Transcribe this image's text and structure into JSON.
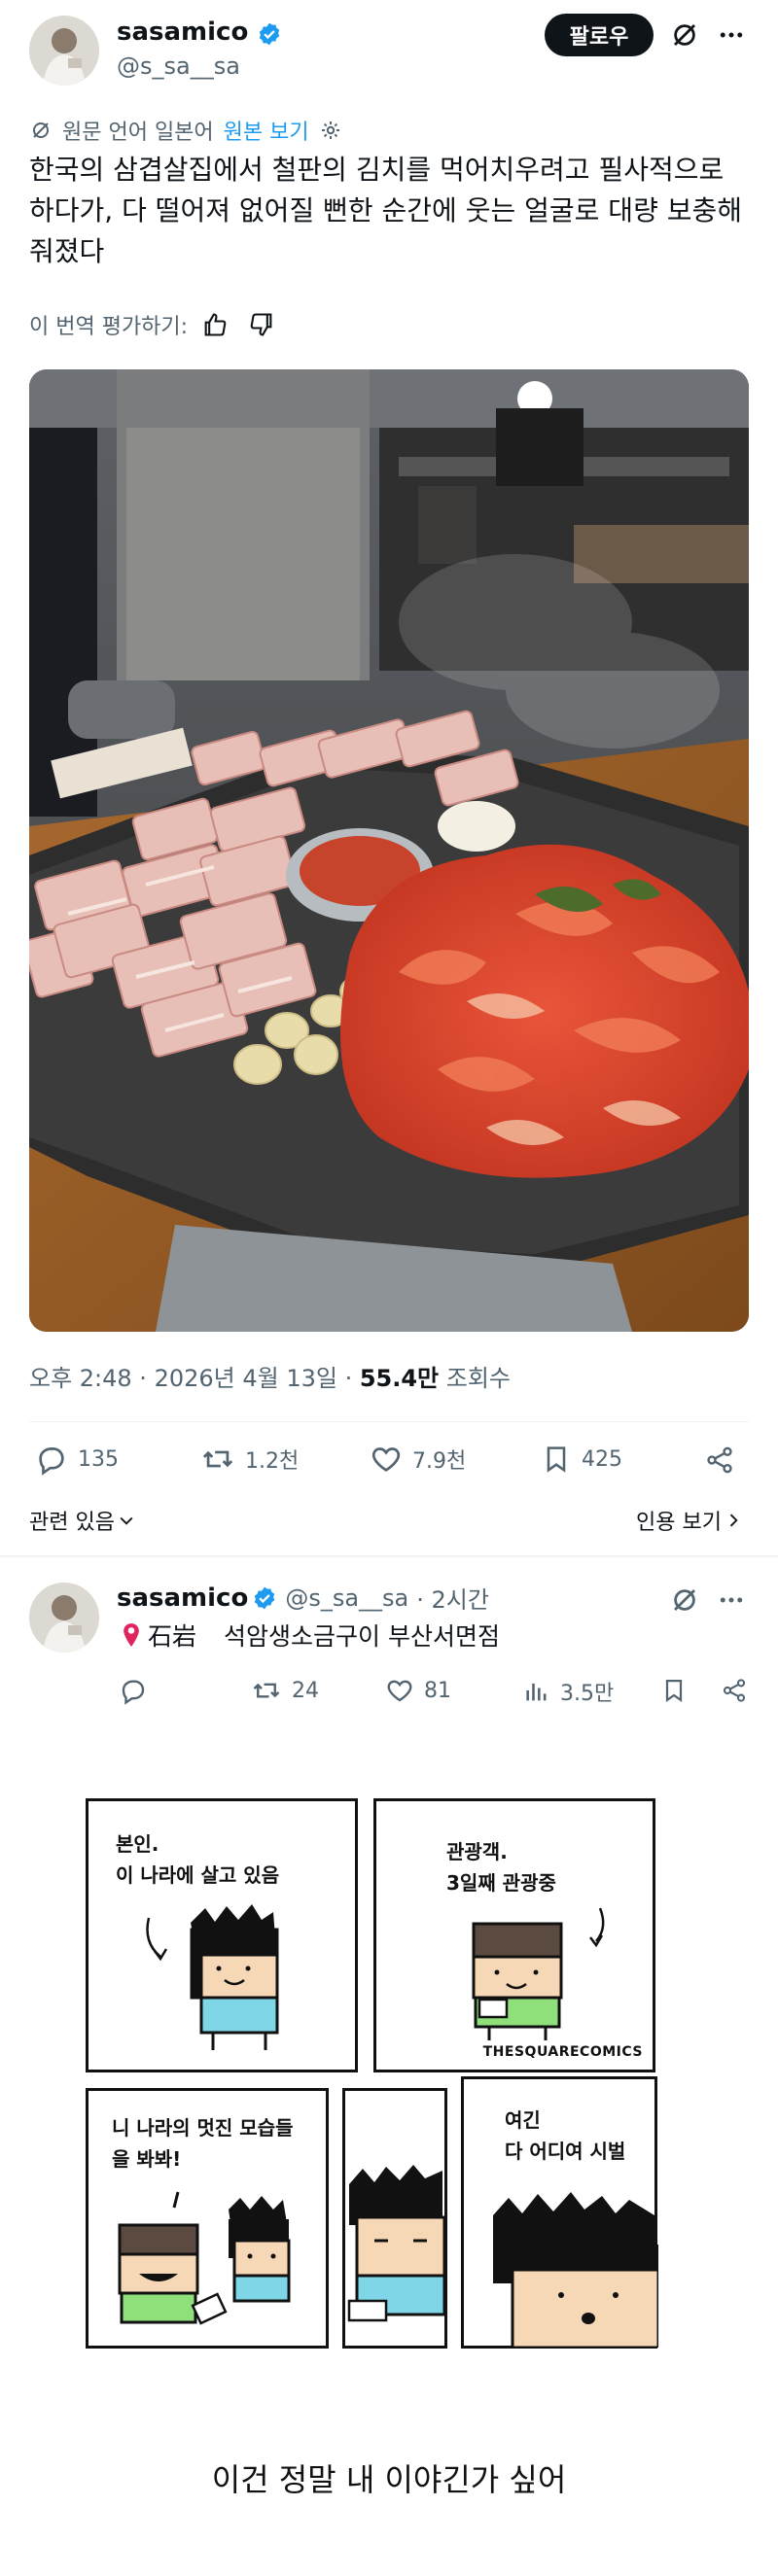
{
  "tweet": {
    "author_name": "sasamico",
    "author_handle": "@s_sa__sa",
    "follow_label": "팔로우",
    "translation_note": "원문 언어 일본어",
    "show_original": "원본 보기",
    "text": "한국의 삼겹살집에서 철판의 김치를 먹어치우려고 필사적으로 하다가, 다 떨어져 없어질 뻔한 순간에 웃는 얼굴로 대량 보충해줘졌다",
    "rate_translation": "이 번역 평가하기:",
    "time": "오후 2:48 · 2026년 4월 13일 · ",
    "views_count": "55.4만",
    "views_label": " 조회수",
    "stats": {
      "replies": "135",
      "retweets": "1.2천",
      "likes": "7.9천",
      "bookmarks": "425"
    },
    "related": "관련 있음",
    "quotes": "인용 보기"
  },
  "reply": {
    "author_name": "sasamico",
    "author_handle": "@s_sa__sa",
    "age": "· 2시간",
    "location_pin": "石岩",
    "text": "석암생소금구이 부산서면점",
    "stats": {
      "retweets": "24",
      "likes": "81",
      "views": "3.5만"
    }
  },
  "comic": {
    "panel1": [
      "본인.",
      "이 나라에 살고 있음"
    ],
    "panel2": [
      "관광객.",
      "3일째 관광중"
    ],
    "signature": "THESQUARECOMICS",
    "panel3": [
      "니 나라의 멋진 모습들",
      "을 봐봐!"
    ],
    "panel5": [
      "여긴",
      "다 어디여 시벌"
    ]
  },
  "caption": "이건 정말 내 이야긴가 싶어",
  "colors": {
    "verified": "#1d9bf0",
    "text": "#0f1419",
    "secondary": "#536471"
  }
}
